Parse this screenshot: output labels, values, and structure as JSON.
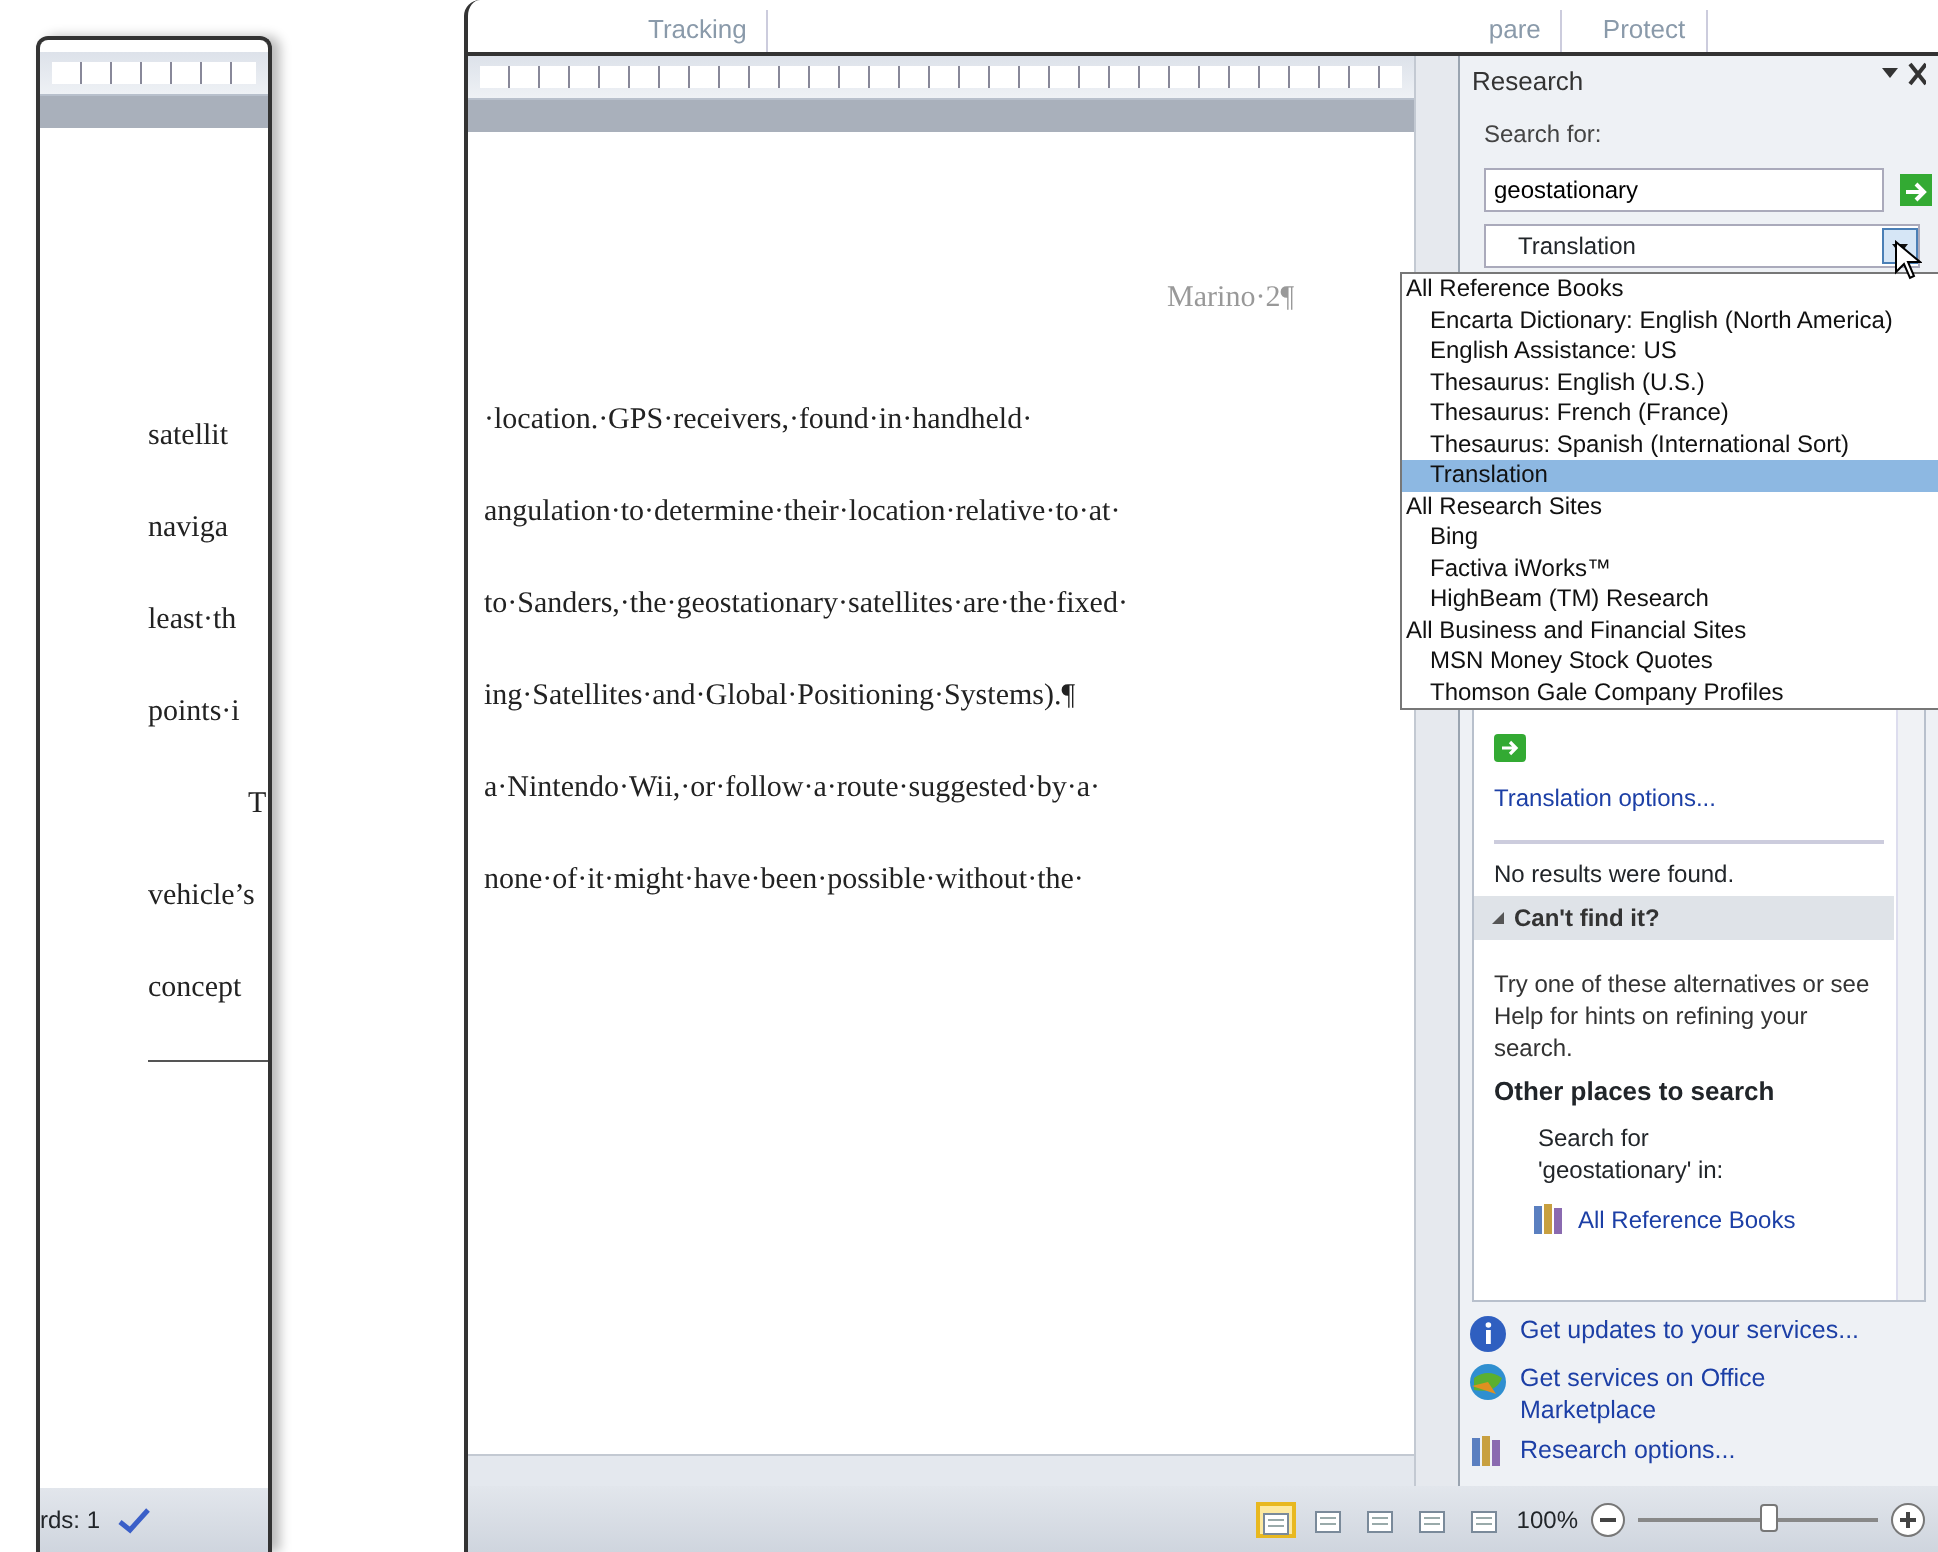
{
  "ribbon_tabs": [
    {
      "label": "Tracking"
    },
    {
      "label": "pare"
    },
    {
      "label": "Protect"
    }
  ],
  "left_page": {
    "lines": [
      {
        "text": "satellit",
        "indent": false
      },
      {
        "text": "naviga",
        "indent": false
      },
      {
        "text": "least·th",
        "indent": false
      },
      {
        "text": "points·i",
        "indent": false
      },
      {
        "text": "T",
        "indent": true
      },
      {
        "text": "vehicle’s",
        "indent": false
      },
      {
        "text": "concept",
        "indent": false
      }
    ],
    "status": "rds: 1"
  },
  "document": {
    "header": "Marino·2¶",
    "lines": [
      "·location.·GPS·receivers,·found·in·handheld·",
      "angulation·to·determine·their·location·relative·to·at·",
      "to·Sanders,·the·geostationary·satellites·are·the·fixed·",
      "ing·Satellites·and·Global·Positioning·Systems).¶",
      "a·Nintendo·Wii,·or·follow·a·route·suggested·by·a·",
      "none·of·it·might·have·been·possible·without·the·"
    ]
  },
  "research": {
    "title": "Research",
    "search_label": "Search for:",
    "query": "geostationary",
    "source": "Translation",
    "dropdown": [
      {
        "label": "All Reference Books",
        "selected": false,
        "children": [
          {
            "label": "Encarta Dictionary: English (North America)",
            "selected": false
          },
          {
            "label": "English Assistance: US",
            "selected": false
          },
          {
            "label": "Thesaurus: English (U.S.)",
            "selected": false
          },
          {
            "label": "Thesaurus: French (France)",
            "selected": false
          },
          {
            "label": "Thesaurus: Spanish (International Sort)",
            "selected": false
          },
          {
            "label": "Translation",
            "selected": true
          }
        ]
      },
      {
        "label": "All Research Sites",
        "selected": false,
        "children": [
          {
            "label": "Bing",
            "selected": false
          },
          {
            "label": "Factiva iWorks™",
            "selected": false
          },
          {
            "label": "HighBeam (TM) Research",
            "selected": false
          }
        ]
      },
      {
        "label": "All Business and Financial Sites",
        "selected": false,
        "children": [
          {
            "label": "MSN Money Stock Quotes",
            "selected": false
          },
          {
            "label": "Thomson Gale Company Profiles",
            "selected": false
          }
        ]
      }
    ],
    "options_link": "Translation options...",
    "no_results": "No results were found.",
    "section": {
      "label": "Can't find it?",
      "expanded": true
    },
    "hint": "Try one of these alternatives or see Help for hints on refining your search.",
    "other_heading": "Other places to search",
    "search_for": "Search for 'geostationary' in:",
    "links": [
      "All Reference Books"
    ],
    "footer_links": [
      {
        "kind": "info",
        "label": "Get updates to your services..."
      },
      {
        "kind": "globe",
        "label": "Get services on Office Marketplace"
      },
      {
        "kind": "book",
        "label": "Research options..."
      }
    ]
  },
  "status_bar": {
    "view_buttons": [
      {
        "selected": true
      },
      {
        "selected": false
      },
      {
        "selected": false
      },
      {
        "selected": false
      },
      {
        "selected": false
      }
    ],
    "zoom": "100%",
    "zoom_slider": {
      "level": 0.55
    }
  }
}
